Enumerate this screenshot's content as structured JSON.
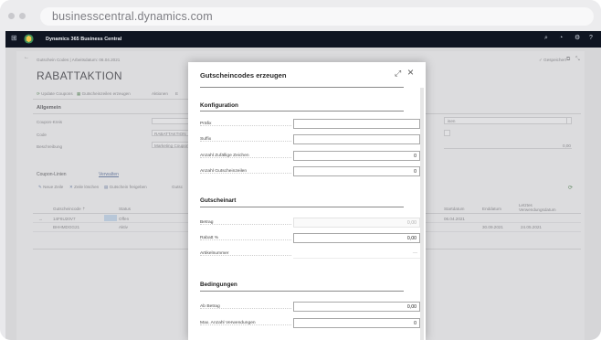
{
  "browser": {
    "url": "businesscentral.dynamics.com"
  },
  "topbar": {
    "app_name": "Dynamics 365 Business Central"
  },
  "background": {
    "breadcrumb": "Gutschein Codes | Arbeitsdatum: 06.04.2021",
    "title": "RABATTAKTION",
    "saved_status": "✓ Gespeichert",
    "actions": [
      "Update Coupons",
      "Gutscheinzeilen erzeugen",
      "Aktionen",
      "E"
    ],
    "general_section": "Allgemein",
    "fields": [
      {
        "label": "Coupon-Kreis",
        "value": ""
      },
      {
        "label": "Code",
        "value": "RABATTAKTION"
      },
      {
        "label": "Beschreibung",
        "value": "Marketing Coupon"
      }
    ],
    "right_value": "0,00",
    "lines_tab": "Coupon-Linien",
    "manage_tab": "Verwalten",
    "line_actions": [
      "Neue Zeile",
      "Zeile löschen",
      "Gutschein freigeben",
      "Gutsc"
    ],
    "columns": [
      "Gutscheincode ⇡",
      "Status"
    ],
    "right_columns": [
      "Startdatum",
      "Enddatum",
      "Letztes Verwendungsdatum"
    ],
    "rows": [
      {
        "code": "14F6U20V7",
        "status": "Offen",
        "start": "06.04.2021",
        "end": "",
        "last": ""
      },
      {
        "code": "BHHMDGG21",
        "status": "Aktiv",
        "start": "",
        "end": "30.09.2021",
        "last": "24.05.2021"
      }
    ]
  },
  "modal": {
    "title": "Gutscheincodes erzeugen",
    "sections": {
      "config": "Konfiguration",
      "type": "Gutscheinart",
      "conditions": "Bedingungen"
    },
    "fields": {
      "prefix": {
        "label": "Präfix",
        "value": ""
      },
      "suffix": {
        "label": "Suffix",
        "value": ""
      },
      "random_chars": {
        "label": "Anzahl Zufällige Zeichen",
        "value": "0"
      },
      "num_lines": {
        "label": "Anzahl Gutscheinzeilen",
        "value": "0"
      },
      "amount": {
        "label": "Betrag",
        "value": "0,00"
      },
      "discount": {
        "label": "Rabatt %",
        "value": "0,00"
      },
      "item_no": {
        "label": "Artikelnummer",
        "value": "—"
      },
      "min_amount": {
        "label": "Ab Betrag",
        "value": "0,00"
      },
      "max_uses": {
        "label": "Max. Anzahl Verwendungen",
        "value": "0"
      }
    }
  }
}
